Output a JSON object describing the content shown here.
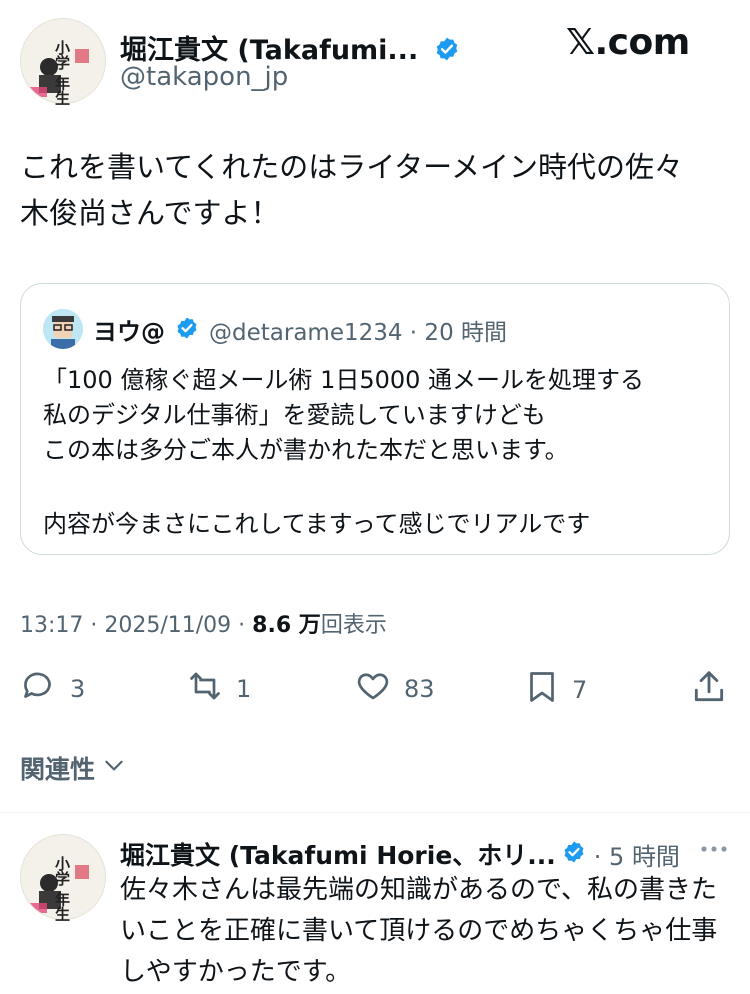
{
  "main_tweet": {
    "author_name": "堀江貴文 (Takafumi...",
    "author_handle": "@takapon_jp",
    "avatar_text": "小学 年生",
    "text_lines": [
      "これを書いてくれたのはライターメイン時代の佐々",
      "木俊尚さんですよ！"
    ]
  },
  "brand": "𝕏.com",
  "quote": {
    "name": "ヨウ@",
    "handle_time": "@detarame1234 · 20 時間",
    "lines": [
      "「100 億稼ぐ超メール術 1日5000 通メールを処理する",
      "私のデジタル仕事術」を愛読していますけども",
      "この本は多分ご本人が書かれた本だと思います。",
      "内容が今まさにこれしてますって感じでリアルです"
    ]
  },
  "meta": {
    "time_date": "13:17 · 2025/11/09 · ",
    "views_count": "8.6 万",
    "views_label": "回表示"
  },
  "actions": {
    "replies": "3",
    "reposts": "1",
    "likes": "83",
    "bookmarks": "7"
  },
  "related": {
    "label": "関連性"
  },
  "reply": {
    "author_name": "堀江貴文 (Takafumi Horie、ホリ...",
    "time": "· 5 時間",
    "text_lines": [
      "佐々木さんは最先端の知識があるので、私の書きた",
      "いことを正確に書いて頂けるのでめちゃくちゃ仕事",
      "しやすかったです。"
    ]
  },
  "colors": {
    "accent": "#1d9bf0",
    "muted": "#536471",
    "border": "#cfd9de"
  }
}
